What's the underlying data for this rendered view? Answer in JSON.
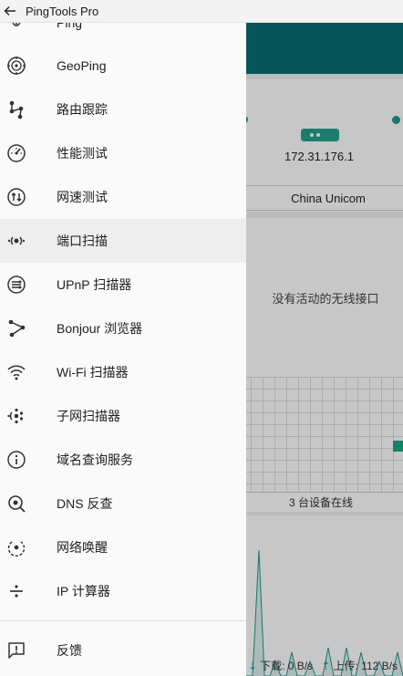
{
  "window": {
    "title": "PingTools Pro"
  },
  "drawer": {
    "partial_item": "Ping",
    "items": [
      {
        "label": "GeoPing",
        "icon": "globe-target-icon"
      },
      {
        "label": "路由跟踪",
        "icon": "route-trace-icon"
      },
      {
        "label": "性能测试",
        "icon": "speedometer-icon"
      },
      {
        "label": "网速测试",
        "icon": "up-down-arrows-icon"
      },
      {
        "label": "端口扫描",
        "icon": "port-scan-icon"
      },
      {
        "label": "UPnP 扫描器",
        "icon": "upnp-icon"
      },
      {
        "label": "Bonjour 浏览器",
        "icon": "bonjour-icon"
      },
      {
        "label": "Wi-Fi 扫描器",
        "icon": "wifi-icon"
      },
      {
        "label": "子网扫描器",
        "icon": "subnet-scan-icon"
      },
      {
        "label": "域名查询服务",
        "icon": "whois-icon"
      },
      {
        "label": "DNS 反查",
        "icon": "dns-lookup-icon"
      },
      {
        "label": "网络唤醒",
        "icon": "wake-on-lan-icon"
      },
      {
        "label": "IP 计算器",
        "icon": "ip-calculator-icon"
      }
    ],
    "feedback": {
      "label": "反馈",
      "icon": "feedback-icon"
    },
    "active_index": 4
  },
  "main": {
    "gateway_ip": "172.31.176.1",
    "isp": "China Unicom",
    "wifi_status": "没有活动的无线接口",
    "devices_online": "3 台设备在线",
    "traffic": {
      "download_label": "下载:",
      "download_value": "0 B/s",
      "upload_label": "上传:",
      "upload_value": "112 B/s"
    }
  },
  "colors": {
    "accent": "#0b6f73",
    "teal": "#1e9a8a"
  }
}
